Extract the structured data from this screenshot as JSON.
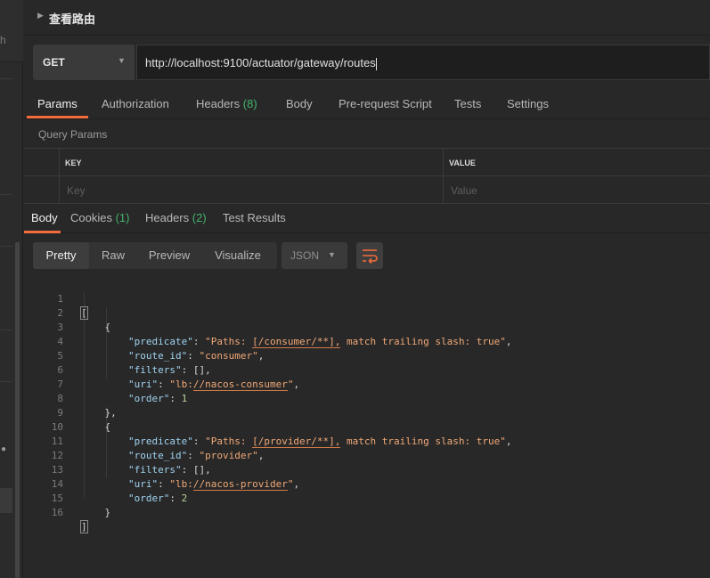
{
  "sidebar": {
    "partial_text": "h"
  },
  "request": {
    "title": "查看路由",
    "method": "GET",
    "url": "http://localhost:9100/actuator/gateway/routes"
  },
  "request_tabs": [
    {
      "label": "Params"
    },
    {
      "label": "Authorization"
    },
    {
      "label": "Headers",
      "count": "(8)"
    },
    {
      "label": "Body"
    },
    {
      "label": "Pre-request Script"
    },
    {
      "label": "Tests"
    },
    {
      "label": "Settings"
    }
  ],
  "query_params": {
    "section_label": "Query Params",
    "key_header": "KEY",
    "value_header": "VALUE",
    "key_placeholder": "Key",
    "value_placeholder": "Value"
  },
  "response_tabs": [
    {
      "label": "Body"
    },
    {
      "label": "Cookies",
      "count": "(1)"
    },
    {
      "label": "Headers",
      "count": "(2)"
    },
    {
      "label": "Test Results"
    }
  ],
  "view_modes": [
    "Pretty",
    "Raw",
    "Preview",
    "Visualize"
  ],
  "format": "JSON",
  "code_lines": [
    "1",
    "2",
    "3",
    "4",
    "5",
    "6",
    "7",
    "8",
    "9",
    "10",
    "11",
    "12",
    "13",
    "14",
    "15",
    "16"
  ],
  "routes": [
    {
      "predicate_key": "\"predicate\"",
      "predicate_prefix": "\"Paths: ",
      "predicate_path": "[/consumer/**],",
      "predicate_suffix": " match trailing slash: true\"",
      "route_id_key": "\"route_id\"",
      "route_id": "\"consumer\"",
      "filters_key": "\"filters\"",
      "filters": "[]",
      "uri_key": "\"uri\"",
      "uri_scheme": "\"lb:",
      "uri_path": "//nacos-consumer",
      "uri_end": "\"",
      "order_key": "\"order\"",
      "order": "1"
    },
    {
      "predicate_key": "\"predicate\"",
      "predicate_prefix": "\"Paths: ",
      "predicate_path": "[/provider/**],",
      "predicate_suffix": " match trailing slash: true\"",
      "route_id_key": "\"route_id\"",
      "route_id": "\"provider\"",
      "filters_key": "\"filters\"",
      "filters": "[]",
      "uri_key": "\"uri\"",
      "uri_scheme": "\"lb:",
      "uri_path": "//nacos-provider",
      "uri_end": "\"",
      "order_key": "\"order\"",
      "order": "2"
    }
  ],
  "colors": {
    "accent": "#f26b3a",
    "count_green": "#44b36c",
    "json_key": "#9fd3f0",
    "json_string": "#f0a878",
    "json_number": "#b5d29a"
  }
}
